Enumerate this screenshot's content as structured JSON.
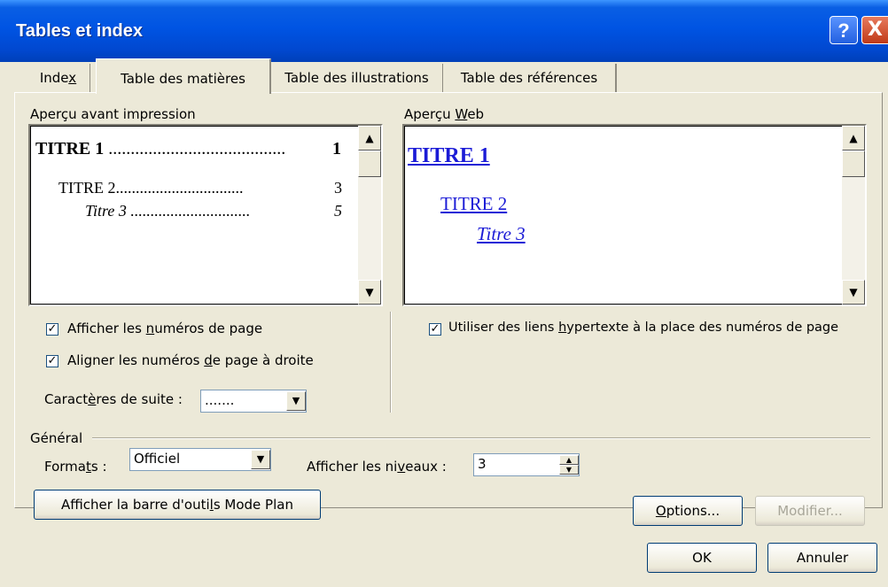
{
  "window": {
    "title": "Tables et index",
    "help": "?",
    "close": "X"
  },
  "tabs": [
    "Index",
    "Table des matières",
    "Table des illustrations",
    "Table des références"
  ],
  "print_preview": {
    "label": "Aperçu avant impression",
    "title1": "TITRE 1",
    "dots1": "........................................",
    "page1": "1",
    "title2": "TITRE 2",
    "dots2": "................................",
    "page2": "3",
    "title3": "Titre 3",
    "dots3": "..............................",
    "page3": "5"
  },
  "web_preview": {
    "label": "Aperçu Web",
    "title1": "TITRE 1",
    "title2": "TITRE 2",
    "title3": "Titre 3"
  },
  "options_left": {
    "show_page_numbers": {
      "label": "Afficher les numéros de page",
      "checked": true
    },
    "align_right": {
      "label": "Aligner les numéros de page à droite",
      "checked": true
    },
    "leader": {
      "label": "Caractères de suite :",
      "value": "......."
    }
  },
  "options_right": {
    "use_hyperlinks": {
      "label": "Utiliser des liens hypertexte à la place des numéros de page",
      "checked": true
    }
  },
  "general": {
    "label": "Général",
    "formats_label": "Formats :",
    "formats_value": "Officiel",
    "levels_label": "Afficher les niveaux :",
    "levels_value": "3"
  },
  "buttons": {
    "outline_toolbar": "Afficher la barre d'outils Mode Plan",
    "options": "Options...",
    "modify": "Modifier...",
    "ok": "OK",
    "cancel": "Annuler"
  },
  "icons": {
    "checkbox": "check-icon",
    "scroll_up": "arrow-up-icon",
    "scroll_down": "arrow-down-icon",
    "dropdown": "chevron-down-icon"
  }
}
